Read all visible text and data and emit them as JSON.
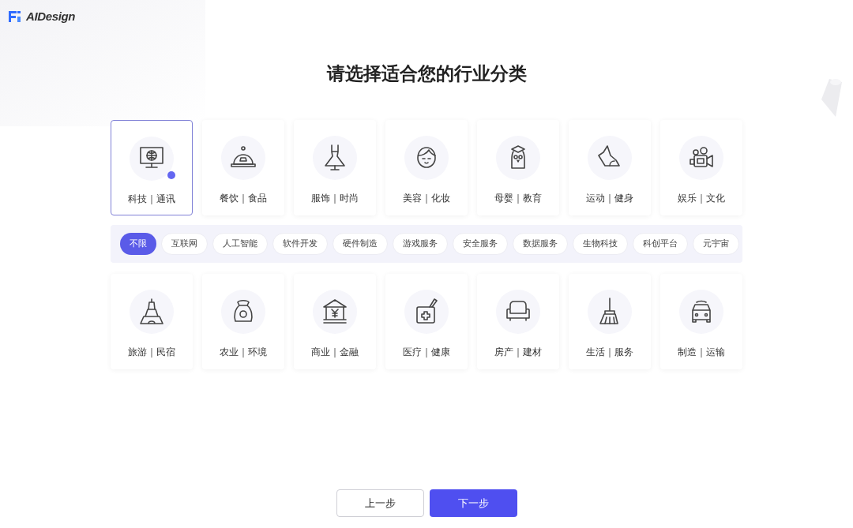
{
  "brand": {
    "name": "AIDesign"
  },
  "title": "请选择适合您的行业分类",
  "categories_top": [
    {
      "label": "科技｜通讯",
      "selected": true
    },
    {
      "label": "餐饮｜食品",
      "selected": false
    },
    {
      "label": "服饰｜时尚",
      "selected": false
    },
    {
      "label": "美容｜化妆",
      "selected": false
    },
    {
      "label": "母婴｜教育",
      "selected": false
    },
    {
      "label": "运动｜健身",
      "selected": false
    },
    {
      "label": "娱乐｜文化",
      "selected": false
    }
  ],
  "subcategories": [
    {
      "label": "不限",
      "selected": true
    },
    {
      "label": "互联网",
      "selected": false
    },
    {
      "label": "人工智能",
      "selected": false
    },
    {
      "label": "软件开发",
      "selected": false
    },
    {
      "label": "硬件制造",
      "selected": false
    },
    {
      "label": "游戏服务",
      "selected": false
    },
    {
      "label": "安全服务",
      "selected": false
    },
    {
      "label": "数据服务",
      "selected": false
    },
    {
      "label": "生物科技",
      "selected": false
    },
    {
      "label": "科创平台",
      "selected": false
    },
    {
      "label": "元宇宙",
      "selected": false
    }
  ],
  "categories_bottom": [
    {
      "label": "旅游｜民宿",
      "selected": false
    },
    {
      "label": "农业｜环境",
      "selected": false
    },
    {
      "label": "商业｜金融",
      "selected": false
    },
    {
      "label": "医疗｜健康",
      "selected": false
    },
    {
      "label": "房产｜建材",
      "selected": false
    },
    {
      "label": "生活｜服务",
      "selected": false
    },
    {
      "label": "制造｜运输",
      "selected": false
    }
  ],
  "buttons": [
    {
      "label": "上一步",
      "kind": "secondary"
    },
    {
      "label": "下一步",
      "kind": "primary"
    }
  ]
}
